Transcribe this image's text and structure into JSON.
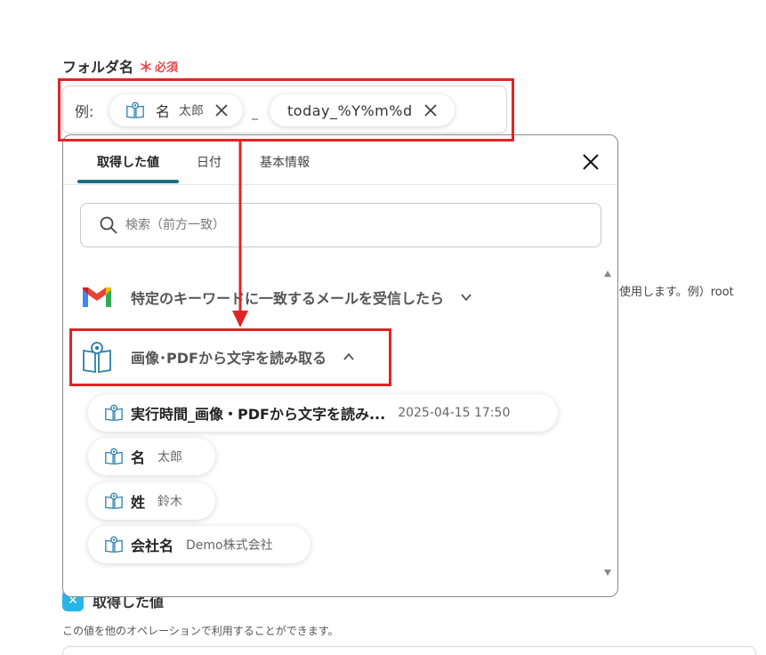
{
  "field": {
    "label": "フォルダ名",
    "required_mark": "＊",
    "required_text": "必須",
    "example_label": "例:",
    "separator": "_",
    "chips": [
      {
        "icon": "ocr-book-icon",
        "name": "名",
        "value": "太郎"
      },
      {
        "text": "today_%Y%m%d"
      }
    ]
  },
  "panel": {
    "tabs": [
      {
        "label": "取得した値",
        "active": true
      },
      {
        "label": "日付",
        "active": false
      },
      {
        "label": "基本情報",
        "active": false
      }
    ],
    "search_placeholder": "検索（前方一致）",
    "sections": [
      {
        "icon": "gmail-icon",
        "title": "特定のキーワードに一致するメールを受信したら",
        "expanded": false
      },
      {
        "icon": "ocr-book-icon",
        "title": "画像･PDFから文字を読み取る",
        "expanded": true
      }
    ],
    "items": [
      {
        "name": "実行時間_画像・PDFから文字を読み...",
        "value": "2025-04-15 17:50"
      },
      {
        "name": "名",
        "value": "太郎"
      },
      {
        "name": "姓",
        "value": "鈴木"
      },
      {
        "name": "会社名",
        "value": "Demo株式会社"
      }
    ]
  },
  "background": {
    "partial_hint": "使用します。例）root",
    "output_section_title": "取得した値",
    "output_section_desc": "この値を他のオペレーションで利用することができます。"
  },
  "colors": {
    "accent": "#1d6f86",
    "required": "#e5484d",
    "highlight_box": "#e02424",
    "icon_blue": "#2a7fa8"
  }
}
